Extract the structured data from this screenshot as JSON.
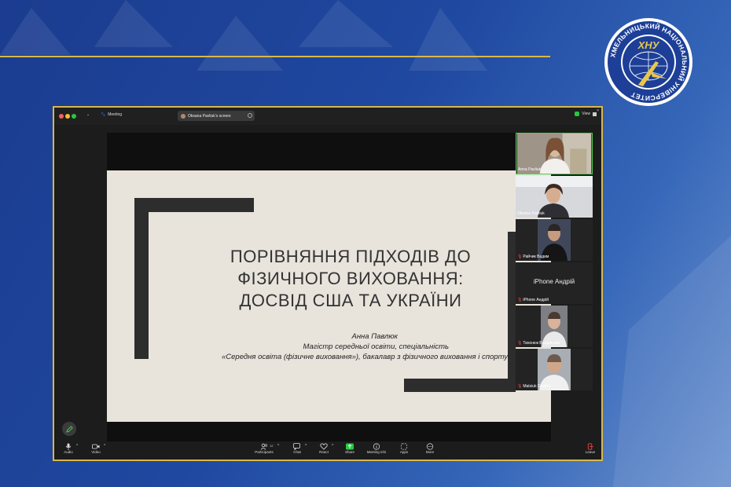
{
  "logo": {
    "text": "ХНУ",
    "ring_text": "ХМЕЛЬНИЦЬКИЙ НАЦІОНАЛЬНИЙ УНІВЕРСИТЕТ"
  },
  "titlebar": {
    "meeting_label": "Meeting",
    "screen_share_label": "Oksana Pavliuk's screen",
    "view_label": "View"
  },
  "slide": {
    "title_lines": [
      "ПОРІВНЯННЯ ПІДХОДІВ ДО",
      "ФІЗИЧНОГО ВИХОВАННЯ:",
      "ДОСВІД США ТА УКРАЇНИ"
    ],
    "author": "Анна Павлюк",
    "subtitle_lines": [
      "Магістр середньої освіти, спеціальність",
      "«Середня освіта (фізичне виховання»), бакалавр з фізичного виховання і спорту"
    ]
  },
  "participants": [
    {
      "name": "Anna Pavliuk",
      "muted": false,
      "active": true,
      "has_video": true
    },
    {
      "name": "Oksana Pavliuk",
      "muted": false,
      "active": false,
      "has_video": true
    },
    {
      "name": "Райчик Вадим",
      "muted": true,
      "active": false,
      "has_video": true
    },
    {
      "name": "iPhone Андрій",
      "muted": true,
      "active": false,
      "has_video": false,
      "center_label": "iPhone Андрій"
    },
    {
      "name": "Тихонюк Владислав",
      "muted": true,
      "active": false,
      "has_video": true
    },
    {
      "name": "Matsiuk Dmytro",
      "muted": true,
      "active": false,
      "has_video": true
    }
  ],
  "toolbar": {
    "audio": "Audio",
    "video": "Video",
    "participants": "Participants",
    "participants_count": "12",
    "chat": "Chat",
    "react": "React",
    "share": "Share",
    "meeting_info": "Meeting info",
    "apps": "Apps",
    "more": "More",
    "leave": "Leave"
  },
  "colors": {
    "gold": "#d8b84a",
    "active_green": "#4dd04d",
    "share_green": "#28c840",
    "slide_bg": "#e8e4dc"
  }
}
